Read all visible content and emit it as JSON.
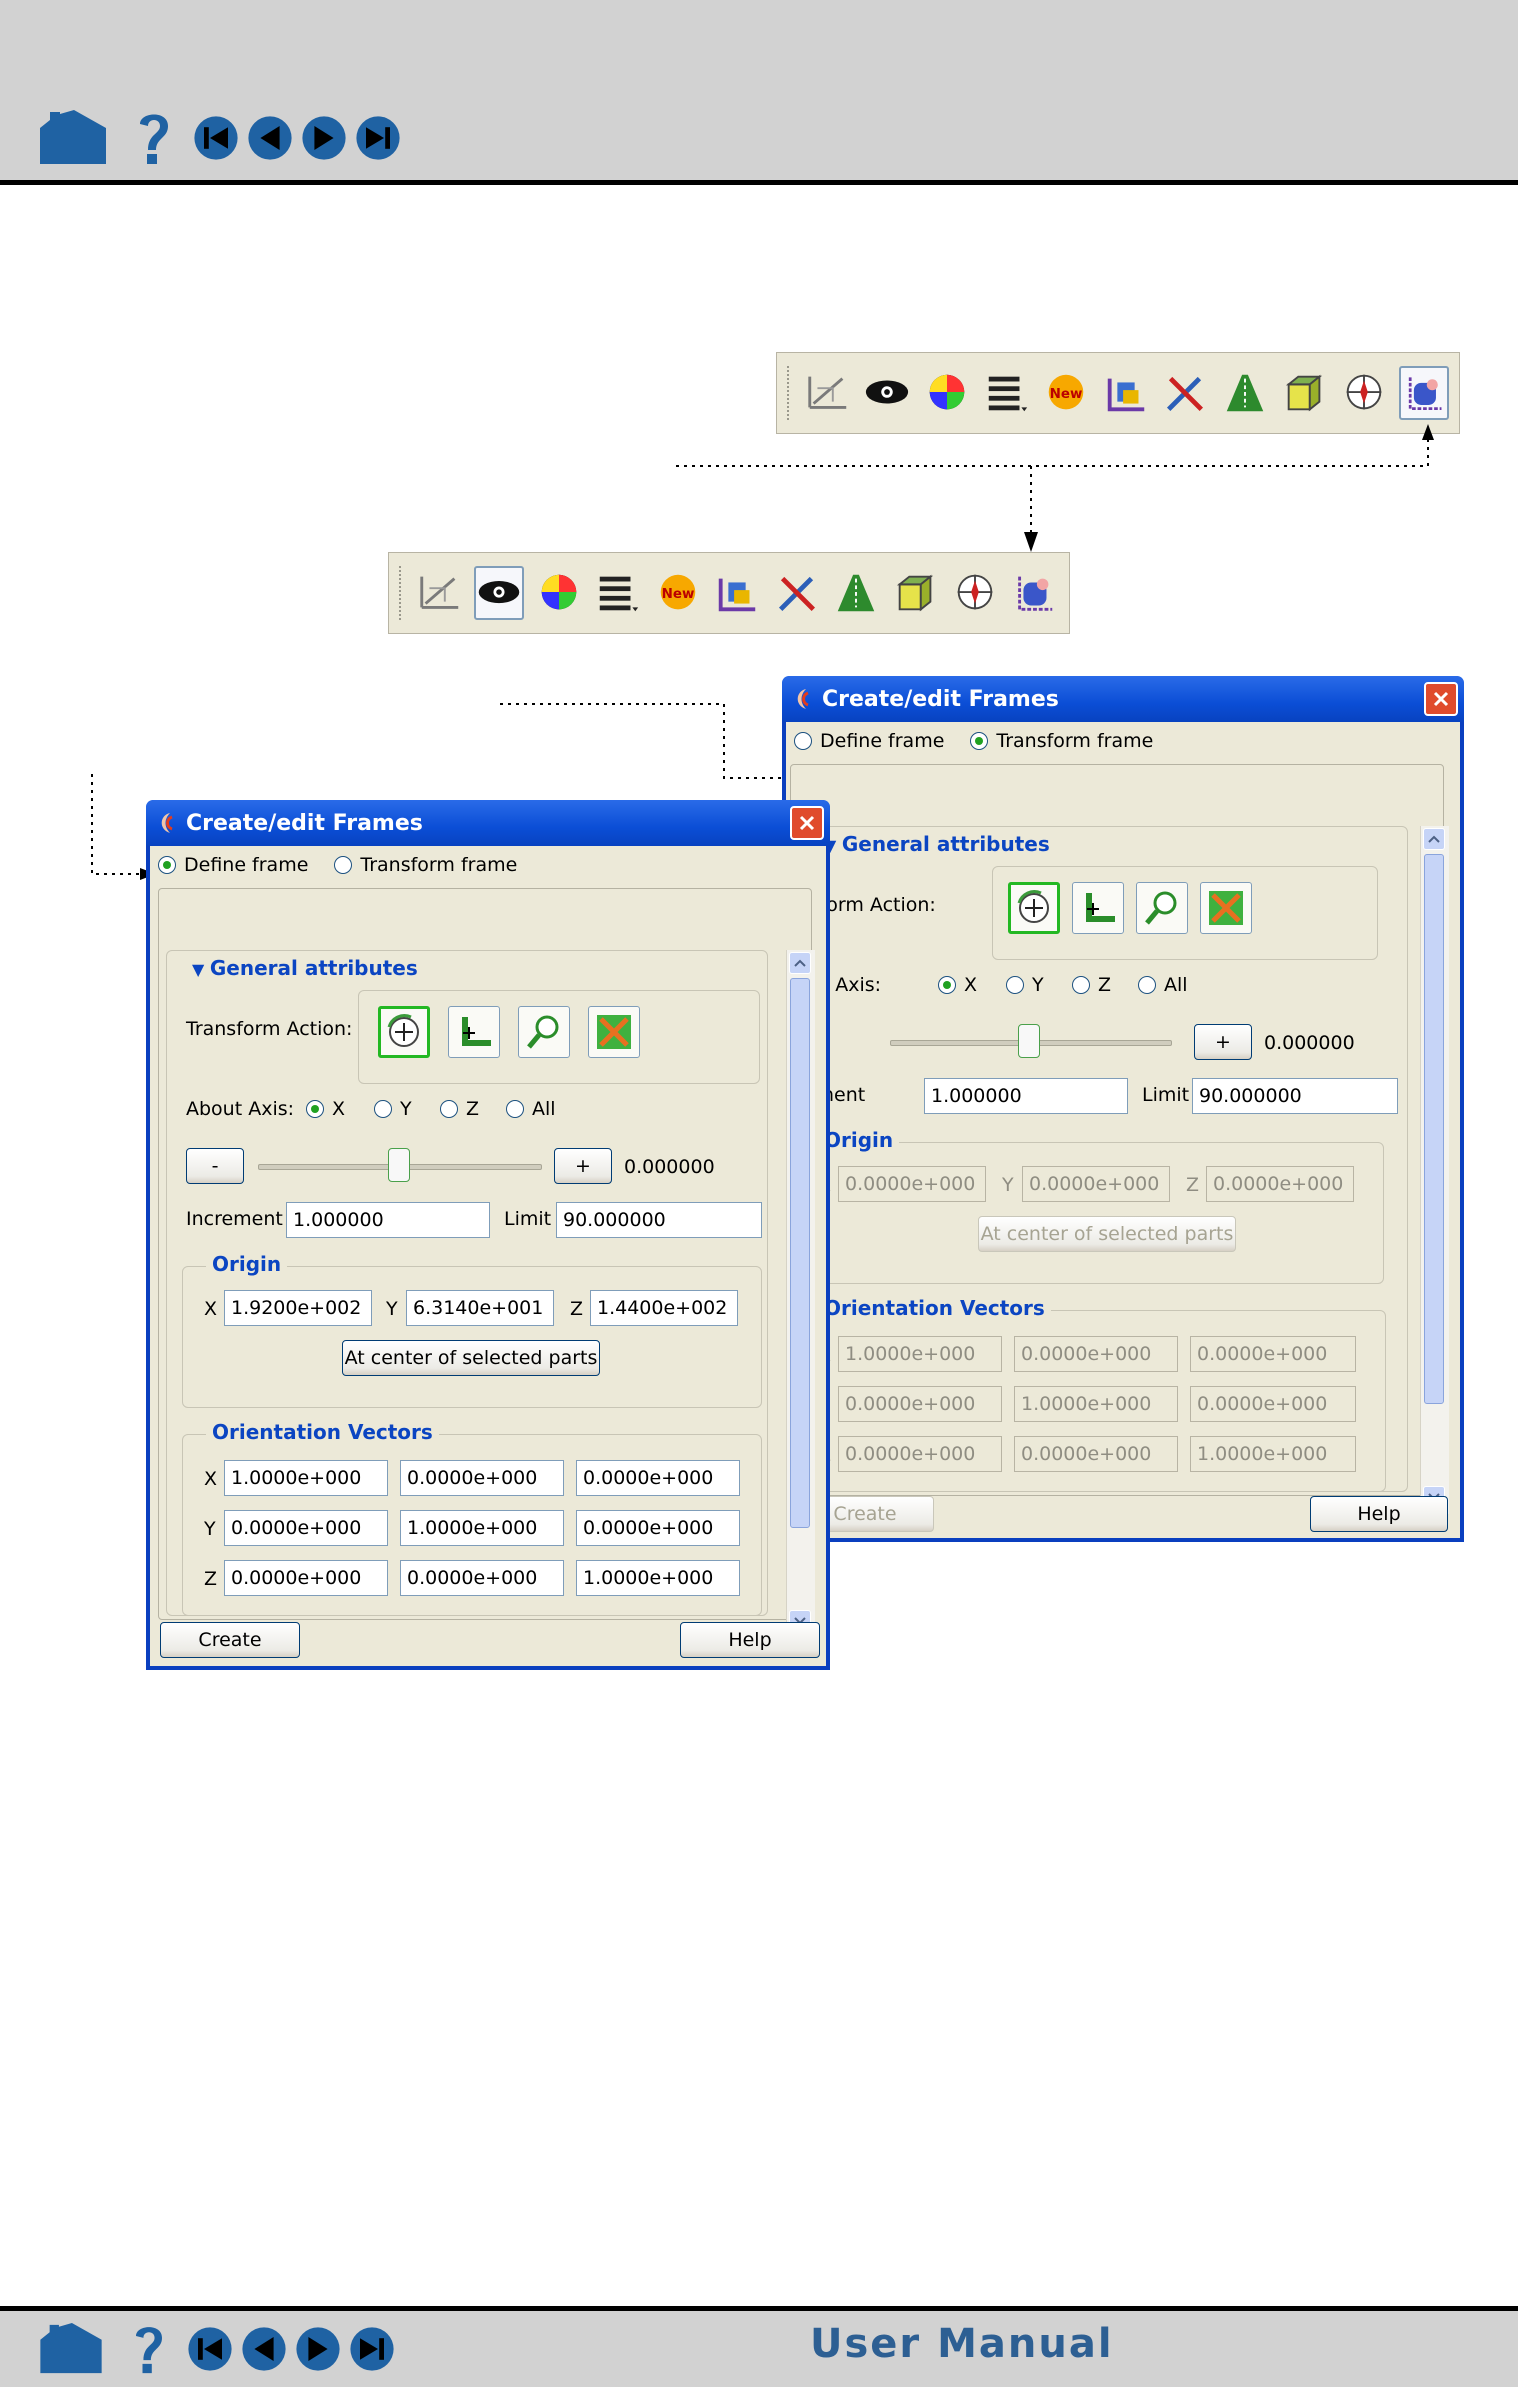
{
  "nav": {
    "icons": [
      "home-icon",
      "help-icon",
      "first-page-icon",
      "previous-page-icon",
      "next-page-icon",
      "last-page-icon"
    ]
  },
  "footer": {
    "title": "User Manual"
  },
  "toolbar_icons": [
    "frame-tool-icon",
    "eye-icon",
    "color-wheel-icon",
    "list-menu-icon",
    "new-badge-icon",
    "lock-frame-icon",
    "tools-icon",
    "road-perspective-icon",
    "cube-icon",
    "compass-icon",
    "frame-mode-icon"
  ],
  "dialog": {
    "title": "Create/edit Frames",
    "radio_define": "Define frame",
    "radio_transform": "Transform frame",
    "general_attributes": "General attributes",
    "transform_action": "Transform Action:",
    "about_axis": "About Axis:",
    "axis_options": [
      "X",
      "Y",
      "Z",
      "All"
    ],
    "minus": "-",
    "plus": "+",
    "slider_value": "0.000000",
    "increment_label": "Increment",
    "increment_value": "1.000000",
    "limit_label": "Limit",
    "limit_value": "90.000000",
    "origin_title": "Origin",
    "coord_x": "X",
    "coord_y": "Y",
    "coord_z": "Z",
    "center_button": "At center of selected parts",
    "orientation_title": "Orientation Vectors",
    "create": "Create",
    "help": "Help"
  },
  "define_dialog": {
    "origin": [
      "1.9200e+002",
      "6.3140e+001",
      "1.4400e+002"
    ],
    "orientation": [
      [
        "1.0000e+000",
        "0.0000e+000",
        "0.0000e+000"
      ],
      [
        "0.0000e+000",
        "1.0000e+000",
        "0.0000e+000"
      ],
      [
        "0.0000e+000",
        "0.0000e+000",
        "1.0000e+000"
      ]
    ]
  },
  "transform_dialog": {
    "transform_action_partial": "ansform Action:",
    "about_axis_partial": "bout Axis:",
    "increment_partial": "crement",
    "origin": [
      "0.0000e+000",
      "0.0000e+000",
      "0.0000e+000"
    ],
    "orientation": [
      [
        "1.0000e+000",
        "0.0000e+000",
        "0.0000e+000"
      ],
      [
        "0.0000e+000",
        "1.0000e+000",
        "0.0000e+000"
      ],
      [
        "0.0000e+000",
        "0.0000e+000",
        "1.0000e+000"
      ]
    ]
  },
  "colors": {
    "bar_bg": "#d2d2d2",
    "nav_blue": "#1f62a3",
    "title_blue": "#0b4ed6",
    "section_blue": "#0b45c2",
    "dialog_bg": "#ece9d8",
    "selected_green": "#23b823"
  }
}
